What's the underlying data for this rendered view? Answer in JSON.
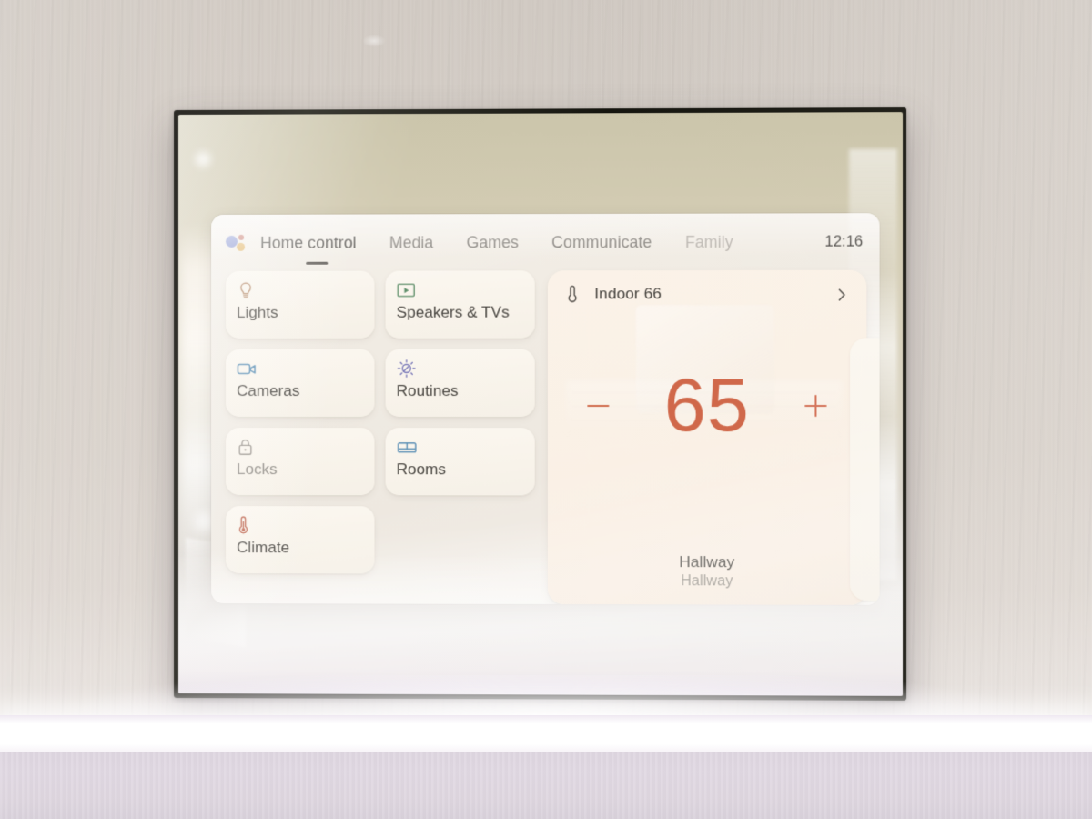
{
  "device": {
    "type": "wall-mounted smart display",
    "frame_color": "#201f19"
  },
  "screen": {
    "background": "#f1ece4",
    "nav": {
      "assistant_icon": "google-assistant-dots-icon",
      "tabs": [
        {
          "label": "Home control",
          "state": "active"
        },
        {
          "label": "Media",
          "state": "inactive"
        },
        {
          "label": "Games",
          "state": "inactive"
        },
        {
          "label": "Communicate",
          "state": "inactive"
        },
        {
          "label": "Family",
          "state": "dim"
        }
      ],
      "clock": "12:16"
    },
    "tiles": [
      {
        "label": "Lights",
        "icon": "lightbulb-icon",
        "icon_color": "#b58b6a",
        "muted": false
      },
      {
        "label": "Speakers & TVs",
        "icon": "cast-screen-icon",
        "icon_color": "#5f8f6a",
        "muted": false
      },
      {
        "label": "Cameras",
        "icon": "video-camera-icon",
        "icon_color": "#5b8fb5",
        "muted": false
      },
      {
        "label": "Routines",
        "icon": "sun-slash-icon",
        "icon_color": "#7a79b8",
        "muted": false
      },
      {
        "label": "Locks",
        "icon": "padlock-icon",
        "icon_color": "#9b968f",
        "muted": true
      },
      {
        "label": "Rooms",
        "icon": "bed-icon",
        "icon_color": "#5b8fb5",
        "muted": false
      },
      {
        "label": "Climate",
        "icon": "thermometer-icon",
        "icon_color": "#c06a55",
        "muted": false
      }
    ],
    "thermostat": {
      "header_icon": "thermometer-icon",
      "header_label": "Indoor 66",
      "chevron_icon": "chevron-right-icon",
      "decrease_label": "−",
      "increase_label": "+",
      "target_temperature": "65",
      "temperature_color": "#d0684a",
      "room_name": "Hallway",
      "device_name": "Hallway"
    }
  }
}
